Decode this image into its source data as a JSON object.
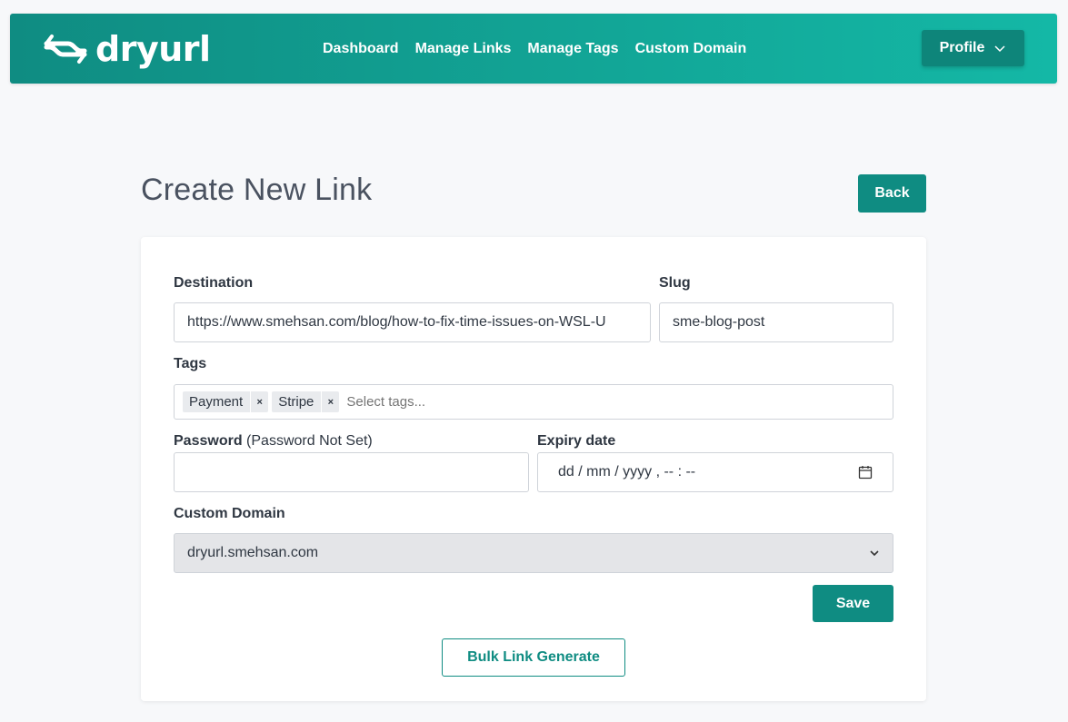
{
  "brand": {
    "name": "dryurl",
    "logo_icon": "dryurl-arrows-logo"
  },
  "nav": {
    "links": [
      {
        "label": "Dashboard"
      },
      {
        "label": "Manage Links"
      },
      {
        "label": "Manage Tags"
      },
      {
        "label": "Custom Domain"
      }
    ],
    "profile_label": "Profile"
  },
  "page": {
    "title": "Create New Link",
    "back_label": "Back"
  },
  "form": {
    "destination_label": "Destination",
    "destination_value": "https://www.smehsan.com/blog/how-to-fix-time-issues-on-WSL-U",
    "slug_label": "Slug",
    "slug_value": "sme-blog-post",
    "tags_label": "Tags",
    "tags": [
      {
        "label": "Payment",
        "remove": "×"
      },
      {
        "label": "Stripe",
        "remove": "×"
      }
    ],
    "tags_placeholder": "Select tags...",
    "password_label": "Password",
    "password_status": "(Password Not Set)",
    "password_value": "",
    "expiry_label": "Expiry date",
    "expiry_placeholder": "dd / mm / yyyy ,  -- : --",
    "custom_domain_label": "Custom Domain",
    "custom_domain_value": "dryurl.smehsan.com",
    "save_label": "Save",
    "bulk_label": "Bulk Link Generate"
  },
  "colors": {
    "primary": "#0f8c82",
    "navbar_gradient_end": "#14b8a6",
    "background": "#f7f8fa"
  }
}
